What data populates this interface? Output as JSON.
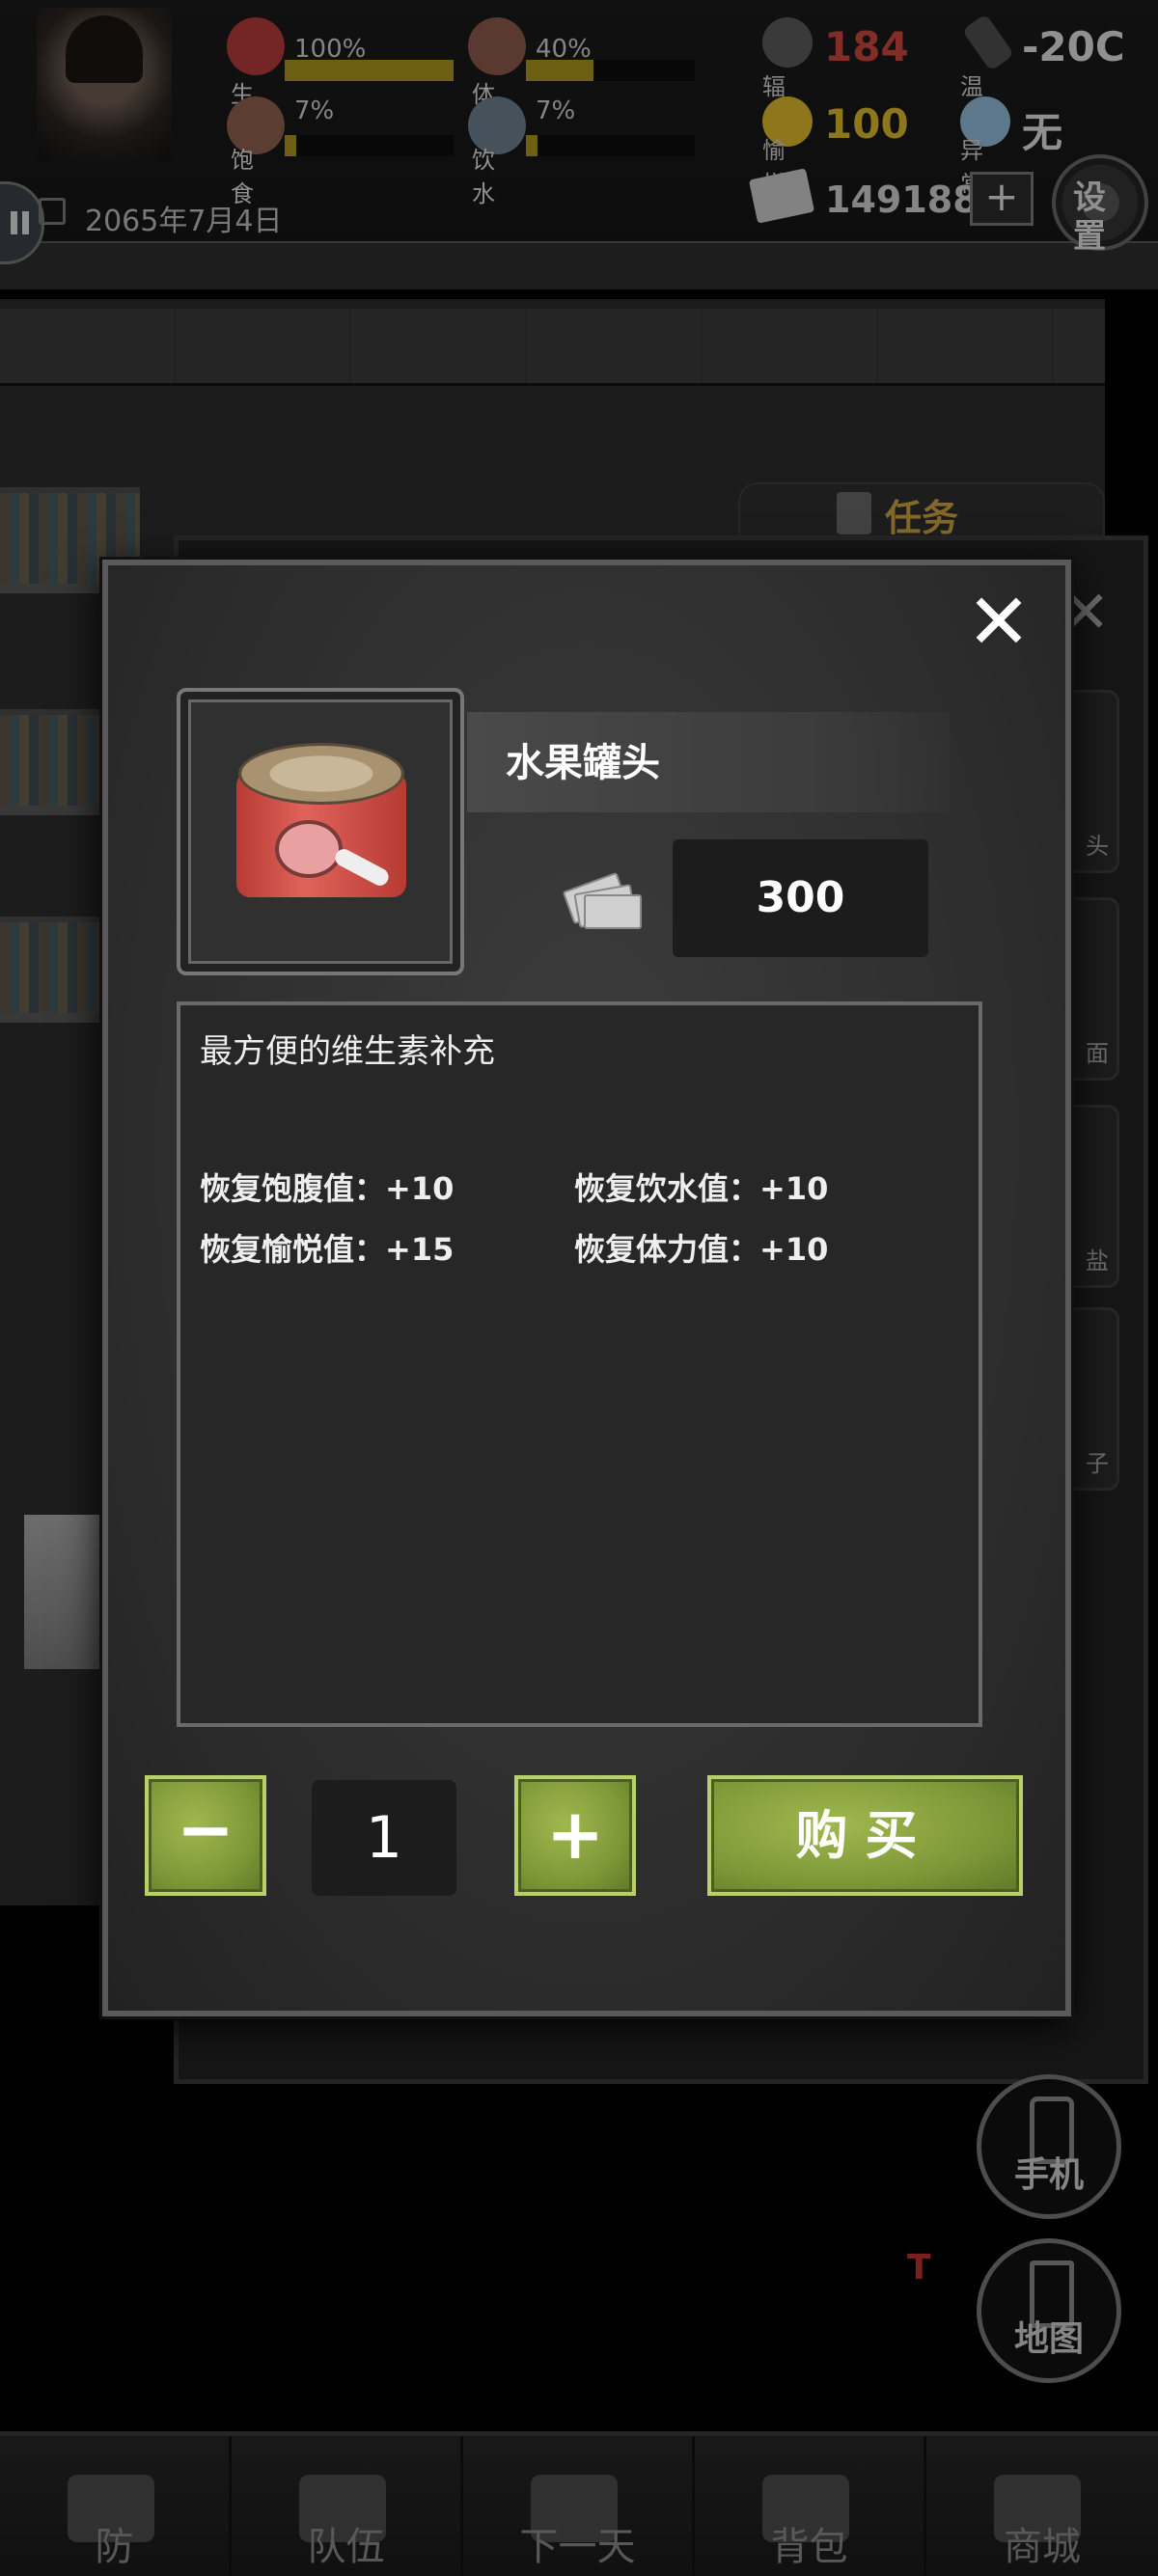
{
  "hud": {
    "stats": [
      {
        "label": "生命",
        "pct": "100%",
        "level": 1.0
      },
      {
        "label": "体力",
        "pct": "40%",
        "level": 0.4
      },
      {
        "label": "饱食",
        "pct": "7%",
        "level": 0.07
      },
      {
        "label": "饮水",
        "pct": "7%",
        "level": 0.07
      }
    ],
    "radiation": {
      "label": "辐射",
      "value": "184"
    },
    "temperature": {
      "label": "温度",
      "value": "-20C"
    },
    "joy": {
      "label": "愉悦",
      "value": "100"
    },
    "abnormal": {
      "label": "异常",
      "value": "无"
    },
    "date": "2065年7月4日",
    "money": "1491881",
    "plus_label": "+",
    "settings_label": "设置"
  },
  "background": {
    "task_tab": "任务",
    "side_items": [
      "头",
      "面",
      "盐",
      "子"
    ]
  },
  "right_buttons": {
    "phone": "手机",
    "map": "地图"
  },
  "bottom_nav": [
    "防",
    "队伍",
    "下一天",
    "背包",
    "商城"
  ],
  "modal": {
    "item_name": "水果罐头",
    "price": "300",
    "description": "最方便的维生素补充",
    "effects": [
      "恢复饱腹值：+10",
      "恢复饮水值：+10",
      "恢复愉悦值：+15",
      "恢复体力值：+10"
    ],
    "minus_label": "−",
    "plus_label": "+",
    "quantity": "1",
    "buy_label": "购买",
    "close_label": "✕"
  },
  "colors": {
    "radiation": "#c8453a",
    "joy": "#d9b52a",
    "button_green": "#8aa640",
    "bar_fill": "#a8921f"
  }
}
